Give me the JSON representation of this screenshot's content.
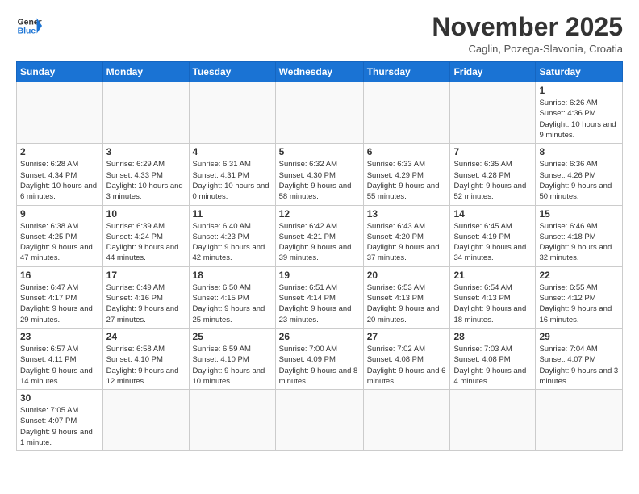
{
  "header": {
    "logo_general": "General",
    "logo_blue": "Blue",
    "month_title": "November 2025",
    "subtitle": "Caglin, Pozega-Slavonia, Croatia"
  },
  "days_of_week": [
    "Sunday",
    "Monday",
    "Tuesday",
    "Wednesday",
    "Thursday",
    "Friday",
    "Saturday"
  ],
  "weeks": [
    [
      {
        "day": "",
        "info": ""
      },
      {
        "day": "",
        "info": ""
      },
      {
        "day": "",
        "info": ""
      },
      {
        "day": "",
        "info": ""
      },
      {
        "day": "",
        "info": ""
      },
      {
        "day": "",
        "info": ""
      },
      {
        "day": "1",
        "info": "Sunrise: 6:26 AM\nSunset: 4:36 PM\nDaylight: 10 hours and 9 minutes."
      }
    ],
    [
      {
        "day": "2",
        "info": "Sunrise: 6:28 AM\nSunset: 4:34 PM\nDaylight: 10 hours and 6 minutes."
      },
      {
        "day": "3",
        "info": "Sunrise: 6:29 AM\nSunset: 4:33 PM\nDaylight: 10 hours and 3 minutes."
      },
      {
        "day": "4",
        "info": "Sunrise: 6:31 AM\nSunset: 4:31 PM\nDaylight: 10 hours and 0 minutes."
      },
      {
        "day": "5",
        "info": "Sunrise: 6:32 AM\nSunset: 4:30 PM\nDaylight: 9 hours and 58 minutes."
      },
      {
        "day": "6",
        "info": "Sunrise: 6:33 AM\nSunset: 4:29 PM\nDaylight: 9 hours and 55 minutes."
      },
      {
        "day": "7",
        "info": "Sunrise: 6:35 AM\nSunset: 4:28 PM\nDaylight: 9 hours and 52 minutes."
      },
      {
        "day": "8",
        "info": "Sunrise: 6:36 AM\nSunset: 4:26 PM\nDaylight: 9 hours and 50 minutes."
      }
    ],
    [
      {
        "day": "9",
        "info": "Sunrise: 6:38 AM\nSunset: 4:25 PM\nDaylight: 9 hours and 47 minutes."
      },
      {
        "day": "10",
        "info": "Sunrise: 6:39 AM\nSunset: 4:24 PM\nDaylight: 9 hours and 44 minutes."
      },
      {
        "day": "11",
        "info": "Sunrise: 6:40 AM\nSunset: 4:23 PM\nDaylight: 9 hours and 42 minutes."
      },
      {
        "day": "12",
        "info": "Sunrise: 6:42 AM\nSunset: 4:21 PM\nDaylight: 9 hours and 39 minutes."
      },
      {
        "day": "13",
        "info": "Sunrise: 6:43 AM\nSunset: 4:20 PM\nDaylight: 9 hours and 37 minutes."
      },
      {
        "day": "14",
        "info": "Sunrise: 6:45 AM\nSunset: 4:19 PM\nDaylight: 9 hours and 34 minutes."
      },
      {
        "day": "15",
        "info": "Sunrise: 6:46 AM\nSunset: 4:18 PM\nDaylight: 9 hours and 32 minutes."
      }
    ],
    [
      {
        "day": "16",
        "info": "Sunrise: 6:47 AM\nSunset: 4:17 PM\nDaylight: 9 hours and 29 minutes."
      },
      {
        "day": "17",
        "info": "Sunrise: 6:49 AM\nSunset: 4:16 PM\nDaylight: 9 hours and 27 minutes."
      },
      {
        "day": "18",
        "info": "Sunrise: 6:50 AM\nSunset: 4:15 PM\nDaylight: 9 hours and 25 minutes."
      },
      {
        "day": "19",
        "info": "Sunrise: 6:51 AM\nSunset: 4:14 PM\nDaylight: 9 hours and 23 minutes."
      },
      {
        "day": "20",
        "info": "Sunrise: 6:53 AM\nSunset: 4:13 PM\nDaylight: 9 hours and 20 minutes."
      },
      {
        "day": "21",
        "info": "Sunrise: 6:54 AM\nSunset: 4:13 PM\nDaylight: 9 hours and 18 minutes."
      },
      {
        "day": "22",
        "info": "Sunrise: 6:55 AM\nSunset: 4:12 PM\nDaylight: 9 hours and 16 minutes."
      }
    ],
    [
      {
        "day": "23",
        "info": "Sunrise: 6:57 AM\nSunset: 4:11 PM\nDaylight: 9 hours and 14 minutes."
      },
      {
        "day": "24",
        "info": "Sunrise: 6:58 AM\nSunset: 4:10 PM\nDaylight: 9 hours and 12 minutes."
      },
      {
        "day": "25",
        "info": "Sunrise: 6:59 AM\nSunset: 4:10 PM\nDaylight: 9 hours and 10 minutes."
      },
      {
        "day": "26",
        "info": "Sunrise: 7:00 AM\nSunset: 4:09 PM\nDaylight: 9 hours and 8 minutes."
      },
      {
        "day": "27",
        "info": "Sunrise: 7:02 AM\nSunset: 4:08 PM\nDaylight: 9 hours and 6 minutes."
      },
      {
        "day": "28",
        "info": "Sunrise: 7:03 AM\nSunset: 4:08 PM\nDaylight: 9 hours and 4 minutes."
      },
      {
        "day": "29",
        "info": "Sunrise: 7:04 AM\nSunset: 4:07 PM\nDaylight: 9 hours and 3 minutes."
      }
    ],
    [
      {
        "day": "30",
        "info": "Sunrise: 7:05 AM\nSunset: 4:07 PM\nDaylight: 9 hours and 1 minute."
      },
      {
        "day": "",
        "info": ""
      },
      {
        "day": "",
        "info": ""
      },
      {
        "day": "",
        "info": ""
      },
      {
        "day": "",
        "info": ""
      },
      {
        "day": "",
        "info": ""
      },
      {
        "day": "",
        "info": ""
      }
    ]
  ]
}
